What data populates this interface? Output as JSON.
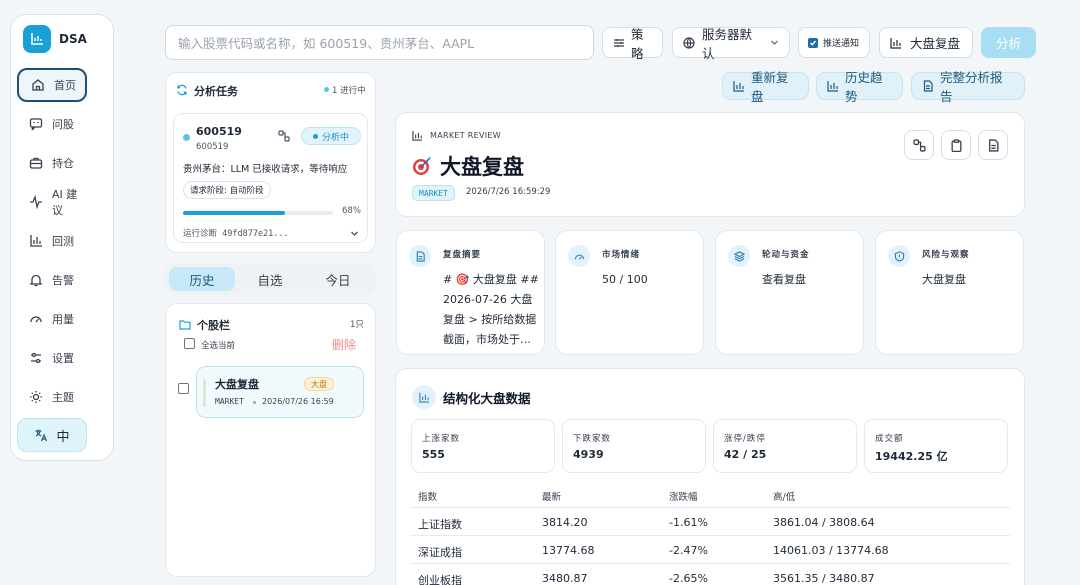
{
  "app": {
    "name": "DSA"
  },
  "sidebar": {
    "items": [
      {
        "label": "首页",
        "icon": "home-icon"
      },
      {
        "label": "问股",
        "icon": "chat-icon"
      },
      {
        "label": "持仓",
        "icon": "briefcase-icon"
      },
      {
        "label": "AI 建议",
        "icon": "activity-icon"
      },
      {
        "label": "回测",
        "icon": "bar-chart-icon"
      },
      {
        "label": "告警",
        "icon": "bell-icon"
      },
      {
        "label": "用量",
        "icon": "gauge-icon"
      },
      {
        "label": "设置",
        "icon": "settings-icon"
      },
      {
        "label": "主题",
        "icon": "sun-icon"
      }
    ],
    "lang_label": "中"
  },
  "topbar": {
    "search_placeholder": "输入股票代码或名称，如 600519、贵州茅台、AAPL",
    "strategy": "策略",
    "server": "服务器默认",
    "push_notice": "推送通知",
    "market_review": "大盘复盘",
    "analyze": "分析"
  },
  "actions": {
    "rerun": "重新复盘",
    "history_trend": "历史趋势",
    "full_report": "完整分析报告"
  },
  "task_panel": {
    "title": "分析任务",
    "running": "1 进行中",
    "task": {
      "code": "600519",
      "sub_code": "600519",
      "status": "分析中",
      "message": "贵州茅台：LLM 已接收请求，等待响应",
      "stage": "请求阶段: 自动阶段",
      "progress": 68,
      "progress_label": "68%",
      "diag": "运行诊断  49fd877e21..."
    }
  },
  "tabs": {
    "history": "历史",
    "watch": "自选",
    "today": "今日"
  },
  "watchlist": {
    "title": "个股栏",
    "count": "1只",
    "select_all": "全选当前",
    "delete": "删除",
    "item": {
      "name": "大盘复盘",
      "badge": "大盘",
      "market": "MARKET",
      "date": "2026/07/26 16:59"
    }
  },
  "review": {
    "eyebrow": "MARKET REVIEW",
    "title": "大盘复盘",
    "tag": "MARKET",
    "timestamp": "2026/7/26 16:59:29"
  },
  "cards": [
    {
      "label": "复盘摘要",
      "value": "# 🎯 大盘复盘 ## 2026-07-26 大盘复盘 > 按所给数据截面，市场处于…",
      "icon": "document-icon"
    },
    {
      "label": "市场情绪",
      "value": "50 / 100",
      "icon": "gauge-icon"
    },
    {
      "label": "轮动与资金",
      "value": "查看复盘",
      "icon": "layers-icon"
    },
    {
      "label": "风险与观察",
      "value": "大盘复盘",
      "icon": "shield-icon"
    }
  ],
  "structured": {
    "title": "结构化大盘数据",
    "metrics": [
      {
        "label": "上涨家数",
        "value": "555"
      },
      {
        "label": "下跌家数",
        "value": "4939"
      },
      {
        "label": "涨停/跌停",
        "value": "42 / 25"
      },
      {
        "label": "成交额",
        "value": "19442.25 亿"
      }
    ],
    "columns": [
      "指数",
      "最新",
      "涨跌幅",
      "高/低"
    ],
    "rows": [
      {
        "name": "上证指数",
        "last": "3814.20",
        "chg": "-1.61%",
        "hl": "3861.04 / 3808.64"
      },
      {
        "name": "深证成指",
        "last": "13774.68",
        "chg": "-2.47%",
        "hl": "14061.03 / 13774.68"
      },
      {
        "name": "创业板指",
        "last": "3480.87",
        "chg": "-2.65%",
        "hl": "3561.35 / 3480.87"
      }
    ]
  },
  "colors": {
    "accent": "#1aa0d8",
    "accent_soft": "#dff3fb",
    "danger": "#ef8a8a"
  }
}
